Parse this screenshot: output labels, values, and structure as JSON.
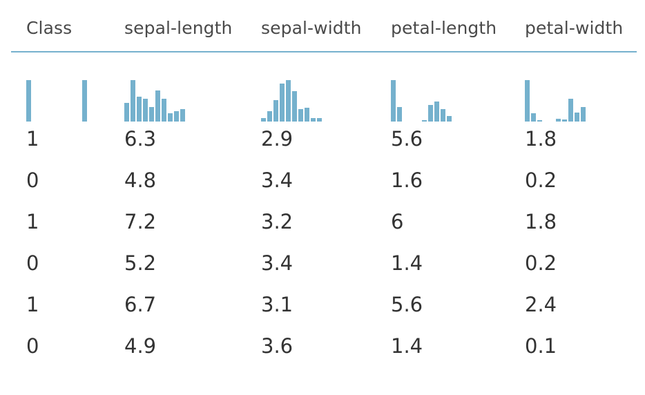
{
  "table": {
    "columns": [
      "Class",
      "sepal-length",
      "sepal-width",
      "petal-length",
      "petal-width"
    ],
    "accent_color": "#75b1cd",
    "histograms": [
      {
        "column": "Class",
        "bins": [
          1.0,
          0,
          0,
          0,
          0,
          0,
          0,
          0,
          0,
          1.0
        ]
      },
      {
        "column": "sepal-length",
        "bins": [
          0.45,
          1.0,
          0.6,
          0.55,
          0.35,
          0.75,
          0.55,
          0.2,
          0.25,
          0.3
        ]
      },
      {
        "column": "sepal-width",
        "bins": [
          0.08,
          0.25,
          0.52,
          0.92,
          1.0,
          0.73,
          0.3,
          0.33,
          0.08,
          0.08
        ]
      },
      {
        "column": "petal-length",
        "bins": [
          1.0,
          0.35,
          0,
          0,
          0,
          0.03,
          0.4,
          0.48,
          0.3,
          0.13
        ]
      },
      {
        "column": "petal-width",
        "bins": [
          1.0,
          0.2,
          0.03,
          0,
          0,
          0.07,
          0.05,
          0.55,
          0.22,
          0.35
        ]
      }
    ],
    "rows": [
      [
        "1",
        "6.3",
        "2.9",
        "5.6",
        "1.8"
      ],
      [
        "0",
        "4.8",
        "3.4",
        "1.6",
        "0.2"
      ],
      [
        "1",
        "7.2",
        "3.2",
        "6",
        "1.8"
      ],
      [
        "0",
        "5.2",
        "3.4",
        "1.4",
        "0.2"
      ],
      [
        "1",
        "6.7",
        "3.1",
        "5.6",
        "2.4"
      ],
      [
        "0",
        "4.9",
        "3.6",
        "1.4",
        "0.1"
      ]
    ]
  }
}
